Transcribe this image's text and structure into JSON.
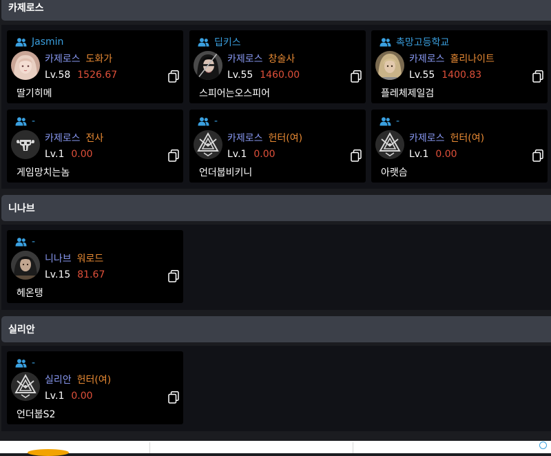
{
  "sections": [
    {
      "title": "카제로스",
      "cards": [
        {
          "guild": "Jasmin",
          "server": "카제로스",
          "cls": "도화가",
          "level": "Lv.58",
          "item_level": "1526.67",
          "name": "딸기히메",
          "avatar": "character-female-avatar"
        },
        {
          "guild": "딥키스",
          "server": "카제로스",
          "cls": "창술사",
          "level": "Lv.55",
          "item_level": "1460.00",
          "name": "스피어는오스피어",
          "avatar": "character-lancer-avatar"
        },
        {
          "guild": "촉망고등학교",
          "server": "카제로스",
          "cls": "홀리나이트",
          "level": "Lv.55",
          "item_level": "1400.83",
          "name": "플레체제일검",
          "avatar": "character-paladin-avatar"
        },
        {
          "guild": "-",
          "server": "카제로스",
          "cls": "전사",
          "level": "Lv.1",
          "item_level": "0.00",
          "name": "게임망치는놈",
          "avatar": "warrior-class-emblem"
        },
        {
          "guild": "-",
          "server": "카제로스",
          "cls": "헌터(여)",
          "level": "Lv.1",
          "item_level": "0.00",
          "name": "언더붑비키니",
          "avatar": "hunter-class-emblem"
        },
        {
          "guild": "-",
          "server": "카제로스",
          "cls": "헌터(여)",
          "level": "Lv.1",
          "item_level": "0.00",
          "name": "아랫슴",
          "avatar": "hunter-class-emblem"
        }
      ]
    },
    {
      "title": "니나브",
      "cards": [
        {
          "guild": "-",
          "server": "니나브",
          "cls": "워로드",
          "level": "Lv.15",
          "item_level": "81.67",
          "name": "헤온탱",
          "avatar": "character-warlord-avatar"
        }
      ]
    },
    {
      "title": "실리안",
      "cards": [
        {
          "guild": "-",
          "server": "실리안",
          "cls": "헌터(여)",
          "level": "Lv.1",
          "item_level": "0.00",
          "name": "언더붑S2",
          "avatar": "hunter-class-emblem"
        }
      ]
    }
  ],
  "icons": {
    "guild": "guild-members-icon",
    "copy": "copy-icon"
  },
  "colors": {
    "server": "#8797f0",
    "class": "#ea8b34",
    "item_level": "#e0503a",
    "guild": "#3aa0e0"
  }
}
